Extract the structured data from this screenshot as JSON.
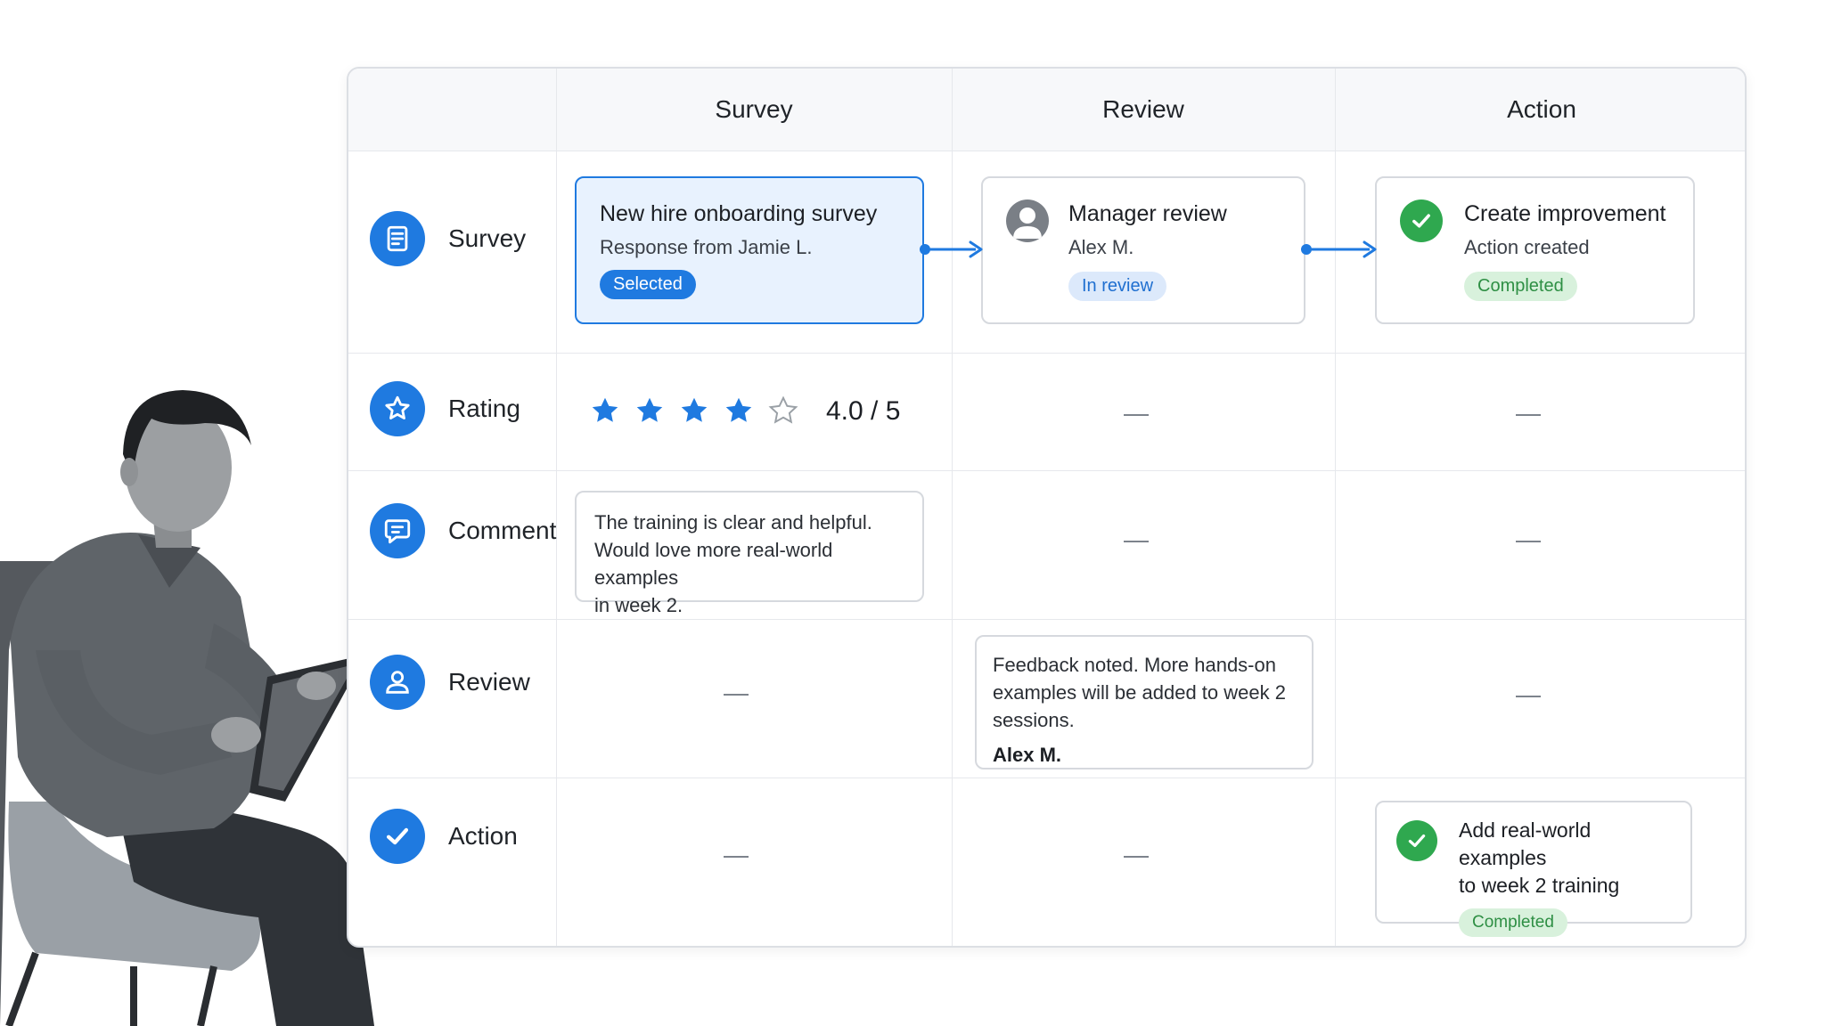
{
  "columns": [
    "Survey",
    "Review",
    "Action"
  ],
  "rows": {
    "survey": "Survey",
    "rating": "Rating",
    "comment": "Comment",
    "review": "Review",
    "action": "Action"
  },
  "survey_card": {
    "title": "New hire onboarding survey",
    "subtitle": "Response from Jamie L.",
    "badge": "Selected"
  },
  "review_card": {
    "title": "Manager review",
    "subtitle": "Alex M.",
    "badge": "In review"
  },
  "action_card": {
    "title": "Create improvement",
    "subtitle": "Action created",
    "badge": "Completed"
  },
  "rating": {
    "stars_filled": 4,
    "stars_total": 5,
    "value_text": "4.0 / 5"
  },
  "comment_card": {
    "lines": [
      "The training is clear and helpful.",
      "Would love more real-world examples",
      "in week 2."
    ]
  },
  "review_note": {
    "lines": [
      "Feedback noted. More hands-on",
      "examples will be added to week 2",
      "sessions."
    ],
    "author": "Alex M."
  },
  "final_action": {
    "lines": [
      "Add real-world examples",
      "to week 2 training"
    ],
    "badge": "Completed"
  },
  "empty_marker": "—",
  "colors": {
    "accent": "#1f7ae0",
    "selected_bg": "#e8f2fe",
    "success": "#2fa84f",
    "success_bg": "#d8f1dc"
  }
}
